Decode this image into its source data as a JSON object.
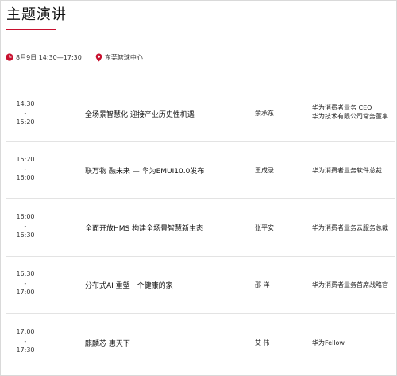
{
  "page": {
    "title": "主题演讲",
    "accent_color": "#c8102e"
  },
  "meta": {
    "date_time": "8月9日 14:30—17:30",
    "date_icon": "clock-icon",
    "venue": "东莞篮球中心",
    "venue_icon": "location-pin-icon"
  },
  "sessions": [
    {
      "time_start": "14:30",
      "time_sep": "-",
      "time_end": "15:20",
      "topic": "全场景智慧化 迎接产业历史性机遇",
      "speaker": "余承东",
      "role_lines": [
        "华为消费者业务 CEO",
        "华为技术有限公司常务董事"
      ]
    },
    {
      "time_start": "15:20",
      "time_sep": "-",
      "time_end": "16:00",
      "topic": "联万物 融未来 — 华为EMUI10.0发布",
      "speaker": "王成录",
      "role_lines": [
        "华为消费者业务软件总裁"
      ]
    },
    {
      "time_start": "16:00",
      "time_sep": "-",
      "time_end": "16:30",
      "topic": "全面开放HMS 构建全场景智慧新生态",
      "speaker": "张平安",
      "role_lines": [
        "华为消费者业务云服务总裁"
      ]
    },
    {
      "time_start": "16:30",
      "time_sep": "-",
      "time_end": "17:00",
      "topic": "分布式AI 重塑一个健康的家",
      "speaker": "邵 洋",
      "role_lines": [
        "华为消费者业务首席战略官"
      ]
    },
    {
      "time_start": "17:00",
      "time_sep": "-",
      "time_end": "17:30",
      "topic": "麒麟芯 惠天下",
      "speaker": "艾 伟",
      "role_lines": [
        "华为Fellow"
      ]
    }
  ]
}
